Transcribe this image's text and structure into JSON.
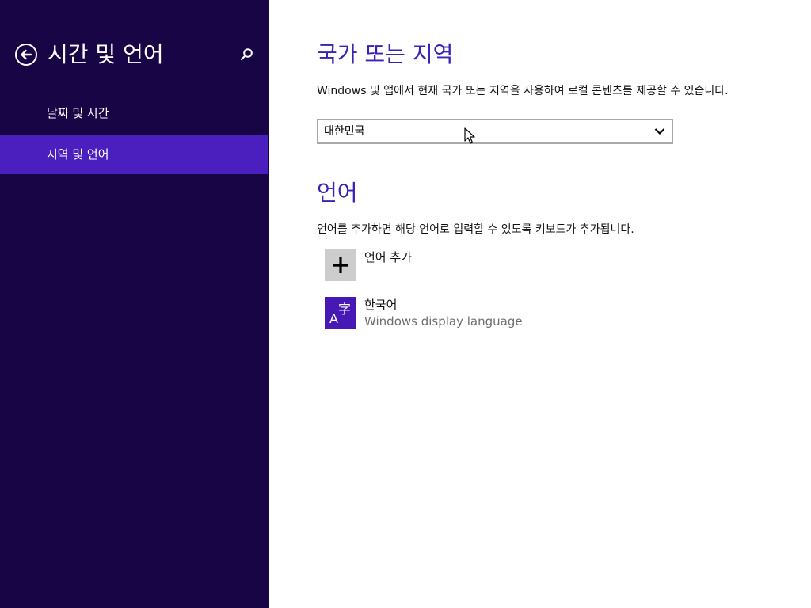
{
  "sidebar": {
    "title": "시간 및 언어",
    "back_icon": "back-arrow-icon",
    "search_icon": "search-icon",
    "items": [
      {
        "label": "날짜 및 시간",
        "selected": false
      },
      {
        "label": "지역 및 언어",
        "selected": true
      }
    ]
  },
  "region": {
    "heading": "국가 또는 지역",
    "description": "Windows 및 앱에서 현재 국가 또는 지역을 사용하여 로컬 콘텐츠를 제공할 수 있습니다.",
    "selected_country": "대한민국"
  },
  "language": {
    "heading": "언어",
    "description": "언어를 추가하면 해당 언어로 입력할 수 있도록 키보드가 추가됩니다.",
    "add_label": "언어 추가",
    "add_icon": "plus-icon",
    "languages": [
      {
        "name": "한국어",
        "subtitle": "Windows display language",
        "icon": "language-icon"
      }
    ]
  },
  "colors": {
    "sidebar_bg": "#180546",
    "selected_item_bg": "#4a1fbd",
    "accent": "#3b21b8",
    "language_tile": "#4618b4"
  }
}
